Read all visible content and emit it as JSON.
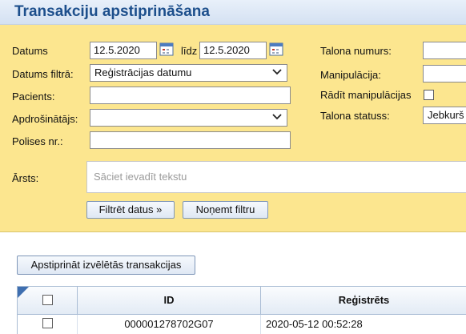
{
  "header": {
    "title": "Transakciju apstiprināšana"
  },
  "filters": {
    "date_label": "Datums",
    "date_from": "12.5.2020",
    "date_to_label": "līdz",
    "date_to": "12.5.2020",
    "date_filter_label": "Datums filtrā:",
    "date_filter_value": "Reģistrācijas datumu",
    "patient_label": "Pacients:",
    "patient_value": "",
    "insurer_label": "Apdrošinātājs:",
    "insurer_value": "",
    "policy_label": "Polises nr.:",
    "policy_value": "",
    "coupon_number_label": "Talona numurs:",
    "coupon_number_value": "",
    "manipulation_label": "Manipulācija:",
    "manipulation_value": "",
    "show_manipulations_label": "Rādīt manipulācijas",
    "show_manipulations_checked": false,
    "coupon_status_label": "Talona statuss:",
    "coupon_status_value": "Jebkurš",
    "doctor_label": "Ārsts:",
    "doctor_placeholder": "Sāciet ievadīt tekstu",
    "filter_button": "Filtrēt datus »",
    "clear_button": "Noņemt filtru"
  },
  "actions": {
    "approve_selected": "Apstiprināt izvēlētās transakcijas"
  },
  "table": {
    "columns": [
      "",
      "ID",
      "Reģistrēts"
    ],
    "rows": [
      {
        "selected": false,
        "id": "000001278702G07",
        "registered": "2020-05-12 00:52:28"
      }
    ]
  },
  "colors": {
    "filter_panel": "#fce68f",
    "title": "#1d4f8c",
    "header_bg": "#d4e1f2"
  }
}
